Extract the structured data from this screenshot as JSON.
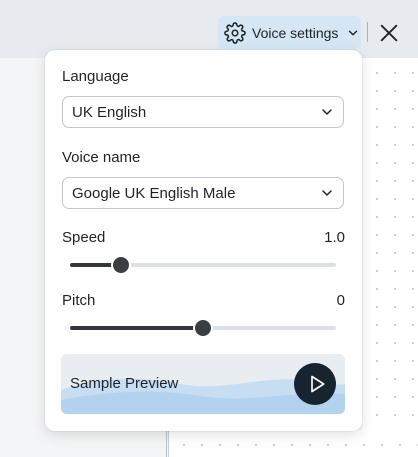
{
  "toolbar": {
    "voice_settings_label": "Voice settings",
    "gear_icon": "gear-icon",
    "chevron_icon": "chevron-down-icon",
    "close_icon": "close-icon"
  },
  "voice_panel": {
    "language": {
      "label": "Language",
      "selected": "UK English"
    },
    "voice_name": {
      "label": "Voice name",
      "selected": "Google UK English Male"
    },
    "speed": {
      "label": "Speed",
      "value": "1.0",
      "position": 0.19
    },
    "pitch": {
      "label": "Pitch",
      "value": "0",
      "position": 0.5
    },
    "preview": {
      "label": "Sample Preview",
      "play_icon": "play-icon"
    }
  },
  "colors": {
    "accent_button_bg": "#d5e6f5",
    "play_button_bg": "#15242f",
    "wave_light": "#b9d6ef",
    "wave_dark": "#a9cbea"
  }
}
